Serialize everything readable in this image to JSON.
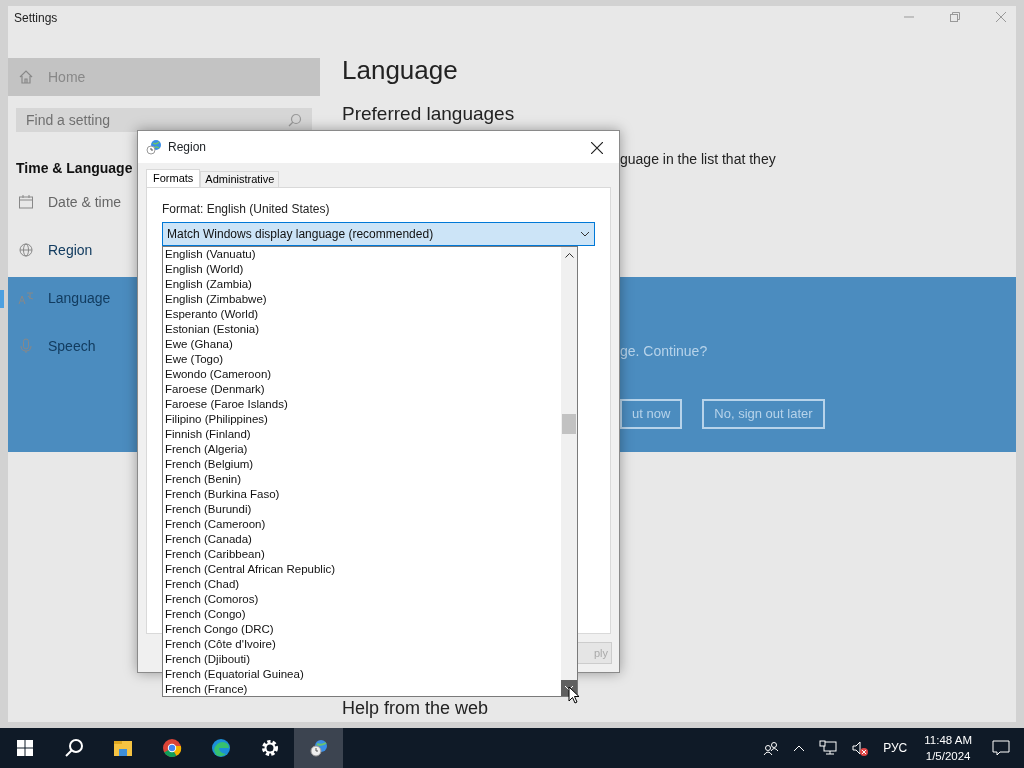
{
  "settings_window": {
    "title": "Settings",
    "sidebar": {
      "home": "Home",
      "search": {
        "placeholder": "Find a setting"
      },
      "section": "Time & Language",
      "items": [
        {
          "label": "Date & time",
          "kind": "calendar",
          "selected": false
        },
        {
          "label": "Region",
          "kind": "globe",
          "selected": false
        },
        {
          "label": "Language",
          "kind": "language",
          "selected": true
        },
        {
          "label": "Speech",
          "kind": "microphone",
          "selected": false
        }
      ]
    },
    "main": {
      "heading": "Language",
      "subheading": "Preferred languages",
      "text": "guage in the list that they",
      "banner": {
        "message": "ge. Continue?",
        "buttons": [
          "ut now",
          "No, sign out later"
        ]
      },
      "help_heading": "Help from the web"
    }
  },
  "region_dialog": {
    "title": "Region",
    "tabs": [
      {
        "label": "Formats",
        "selected": true
      },
      {
        "label": "Administrative",
        "selected": false
      }
    ],
    "format_label": "Format: English (United States)",
    "dropdown": {
      "value": "Match Windows display language (recommended)",
      "expanded": true
    },
    "options": [
      "English (Vanuatu)",
      "English (World)",
      "English (Zambia)",
      "English (Zimbabwe)",
      "Esperanto (World)",
      "Estonian (Estonia)",
      "Ewe (Ghana)",
      "Ewe (Togo)",
      "Ewondo (Cameroon)",
      "Faroese (Denmark)",
      "Faroese (Faroe Islands)",
      "Filipino (Philippines)",
      "Finnish (Finland)",
      "French (Algeria)",
      "French (Belgium)",
      "French (Benin)",
      "French (Burkina Faso)",
      "French (Burundi)",
      "French (Cameroon)",
      "French (Canada)",
      "French (Caribbean)",
      "French (Central African Republic)",
      "French (Chad)",
      "French (Comoros)",
      "French (Congo)",
      "French Congo (DRC)",
      "French (Côte d'Ivoire)",
      "French (Djibouti)",
      "French (Equatorial Guinea)",
      "French (France)"
    ],
    "buttons": [
      {
        "label": "ply",
        "disabled": true
      }
    ]
  },
  "taskbar": {
    "apps": [
      {
        "kind": "start",
        "selected": false
      },
      {
        "kind": "search",
        "selected": false
      },
      {
        "kind": "folder",
        "selected": false
      },
      {
        "kind": "chrome",
        "selected": false
      },
      {
        "kind": "edge",
        "selected": false
      },
      {
        "kind": "gear",
        "selected": false
      },
      {
        "kind": "region",
        "selected": true
      }
    ],
    "tray": {
      "language": "РУС",
      "time": "11:48 AM",
      "date": "1/5/2024"
    }
  }
}
